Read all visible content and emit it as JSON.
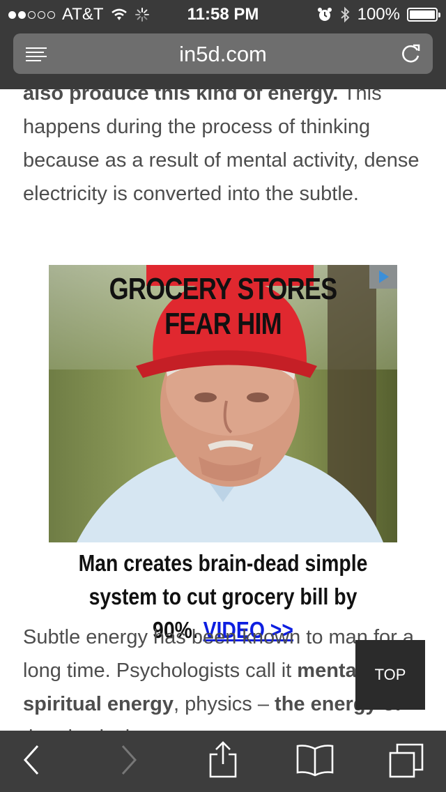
{
  "status_bar": {
    "carrier": "AT&T",
    "time": "11:58 PM",
    "battery": "100%",
    "signal_filled": 2,
    "signal_total": 5
  },
  "browser": {
    "url": "in5d.com",
    "reader_icon": "reader-icon",
    "reload_icon": "reload-icon"
  },
  "article": {
    "p1_first_line_bold": "also produce this kind of energy.",
    "p1_first_line_rest": " This",
    "p1_text": "happens during the process of thinking because as a result of mental activity, dense electricity is converted into the subtle.",
    "p2_text_a": "Subtle energy has been known to man for a long time. Psychologists call it ",
    "p2_bold_a": "mental",
    "p2_text_b": ", ",
    "p2_bold_b": "spiritual energy",
    "p2_text_c": ", physics – ",
    "p2_bold_c": "the energy of",
    "p2_text_d": " the physical vacuum..."
  },
  "ad": {
    "headline": "GROCERY STORES FEAR HIM",
    "body": "Man creates brain-dead simple system to cut grocery bill by 90%.",
    "link": "VIDEO >>",
    "adchoices_icon": "adchoices-icon"
  },
  "top_button": "TOP",
  "toolbar": {
    "back_icon": "back-icon",
    "forward_icon": "forward-icon",
    "share_icon": "share-icon",
    "bookmarks_icon": "bookmarks-icon",
    "tabs_icon": "tabs-icon"
  },
  "colors": {
    "chrome": "#3a3a3a",
    "url_field": "#6e6e6e",
    "text": "#4d4d4d",
    "ad_link": "#0d1ee0",
    "cap_red": "#e0282f"
  }
}
